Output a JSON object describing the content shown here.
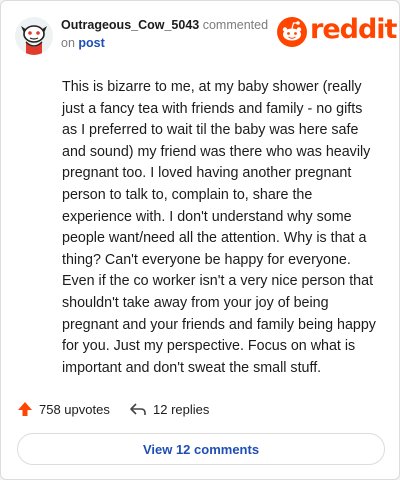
{
  "comment": {
    "author": "Outrageous_Cow_5043",
    "action_text": "commented",
    "on_text": "on",
    "post_link": "post",
    "body": "This is bizarre to me, at my baby shower (really just a fancy tea with friends and family - no gifts as I preferred to wait til the baby was here safe and sound) my friend was there who was heavily pregnant too. I loved having another pregnant person to talk to, complain to, share the experience with. I don't understand why some people want/need all the attention. Why is that a thing? Can't everyone be happy for everyone. Even if the co worker isn't a very nice person that shouldn't take away from your joy of being pregnant and your friends and family being happy for you. Just my perspective. Focus on what is important and don't sweat the small stuff."
  },
  "brand": {
    "wordmark": "reddit",
    "color": "#ff4500"
  },
  "actions": {
    "upvotes_label": "758 upvotes",
    "replies_label": "12 replies",
    "view_comments_label": "View 12 comments"
  },
  "icons": [
    "avatar",
    "reddit-alien-icon",
    "upvote-arrow-icon",
    "reply-arrow-icon"
  ],
  "colors": {
    "accent": "#ff4500",
    "link": "#1f4fb5",
    "text": "#1c1c1c",
    "muted": "#7c7c7c"
  }
}
